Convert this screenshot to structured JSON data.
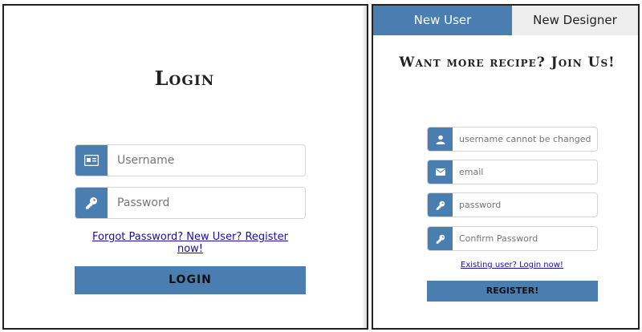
{
  "login": {
    "title": "Login",
    "username_placeholder": "Username",
    "password_placeholder": "Password",
    "link_text": "Forgot Password? New User? Register now!",
    "button_label": "LOGIN",
    "icons": {
      "username": "id-card-icon",
      "password": "key-icon"
    }
  },
  "register": {
    "tabs": [
      {
        "label": "New User",
        "active": true
      },
      {
        "label": "New Designer",
        "active": false
      }
    ],
    "title": "Want more recipe? Join Us!",
    "fields": {
      "username_placeholder": "username cannot be changed",
      "email_placeholder": "email",
      "password_placeholder": "password",
      "confirm_placeholder": "Confirm Password"
    },
    "link_text": "Existing user? Login now!",
    "button_label": "REGISTER!",
    "icons": {
      "username": "user-icon",
      "email": "envelope-icon",
      "password": "key-icon",
      "confirm": "key-icon"
    }
  },
  "colors": {
    "accent": "#4a7eb0",
    "tab_inactive": "#ededed",
    "link": "#1a0dab"
  }
}
